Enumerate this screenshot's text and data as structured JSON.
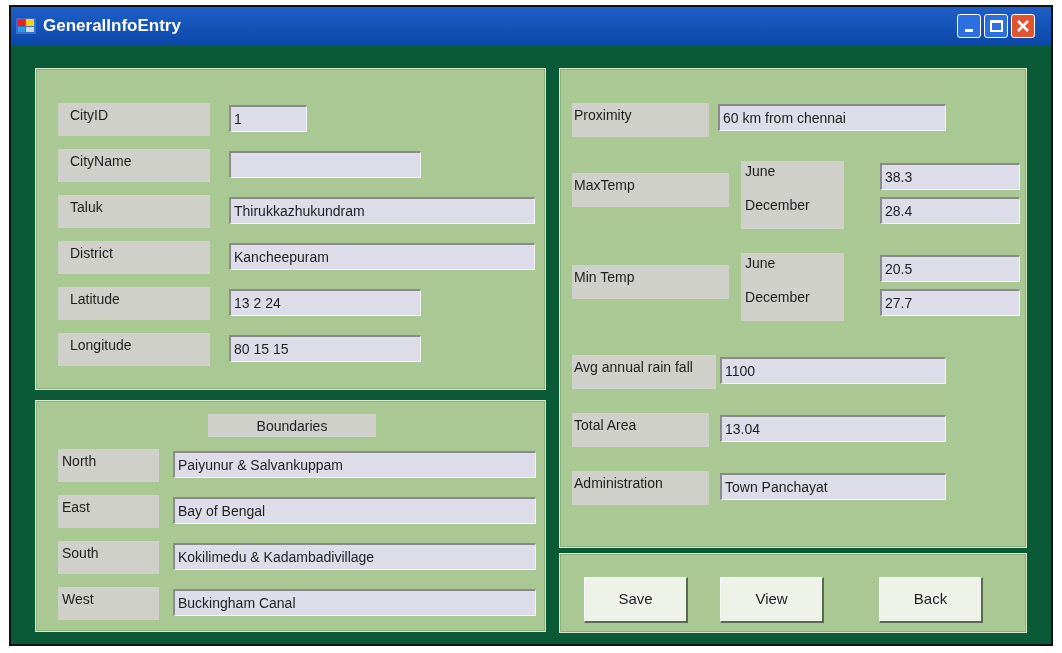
{
  "window": {
    "title": "GeneralInfoEntry"
  },
  "city_fields": [
    {
      "label": "CityID",
      "value": "1"
    },
    {
      "label": "CityName"
    },
    {
      "label": "Taluk",
      "value": "Thirukkazhukundram"
    },
    {
      "label": "District",
      "value": "Kancheepuram"
    },
    {
      "label": "Latitude",
      "value": "13 2 24"
    },
    {
      "label": "Longitude",
      "value": "80 15 15"
    }
  ],
  "boundaries": {
    "title": "Boundaries",
    "rows": [
      {
        "label": "North",
        "value": "Paiyunur & Salvankuppam"
      },
      {
        "label": "East",
        "value": "Bay of Bengal"
      },
      {
        "label": "South",
        "value": "Kokilimedu & Kadambadivillage"
      },
      {
        "label": "West",
        "value": "Buckingham Canal"
      }
    ]
  },
  "proximity": {
    "label": "Proximity",
    "value": "60 km from chennai"
  },
  "temperatures": [
    {
      "label": "MaxTemp",
      "months": [
        {
          "label": "June",
          "value": "38.3"
        },
        {
          "label": "December",
          "value": "28.4"
        }
      ]
    },
    {
      "label": "Min Temp",
      "months": [
        {
          "label": "June",
          "value": "20.5"
        },
        {
          "label": "December",
          "value": "27.7"
        }
      ]
    }
  ],
  "other_fields": [
    {
      "label": "Avg annual rain fall",
      "value": "1100"
    },
    {
      "label": "Total Area",
      "value": "13.04"
    },
    {
      "label": "Administration",
      "value": "Town Panchayat"
    }
  ],
  "buttons": [
    "Save",
    "View",
    "Back"
  ]
}
